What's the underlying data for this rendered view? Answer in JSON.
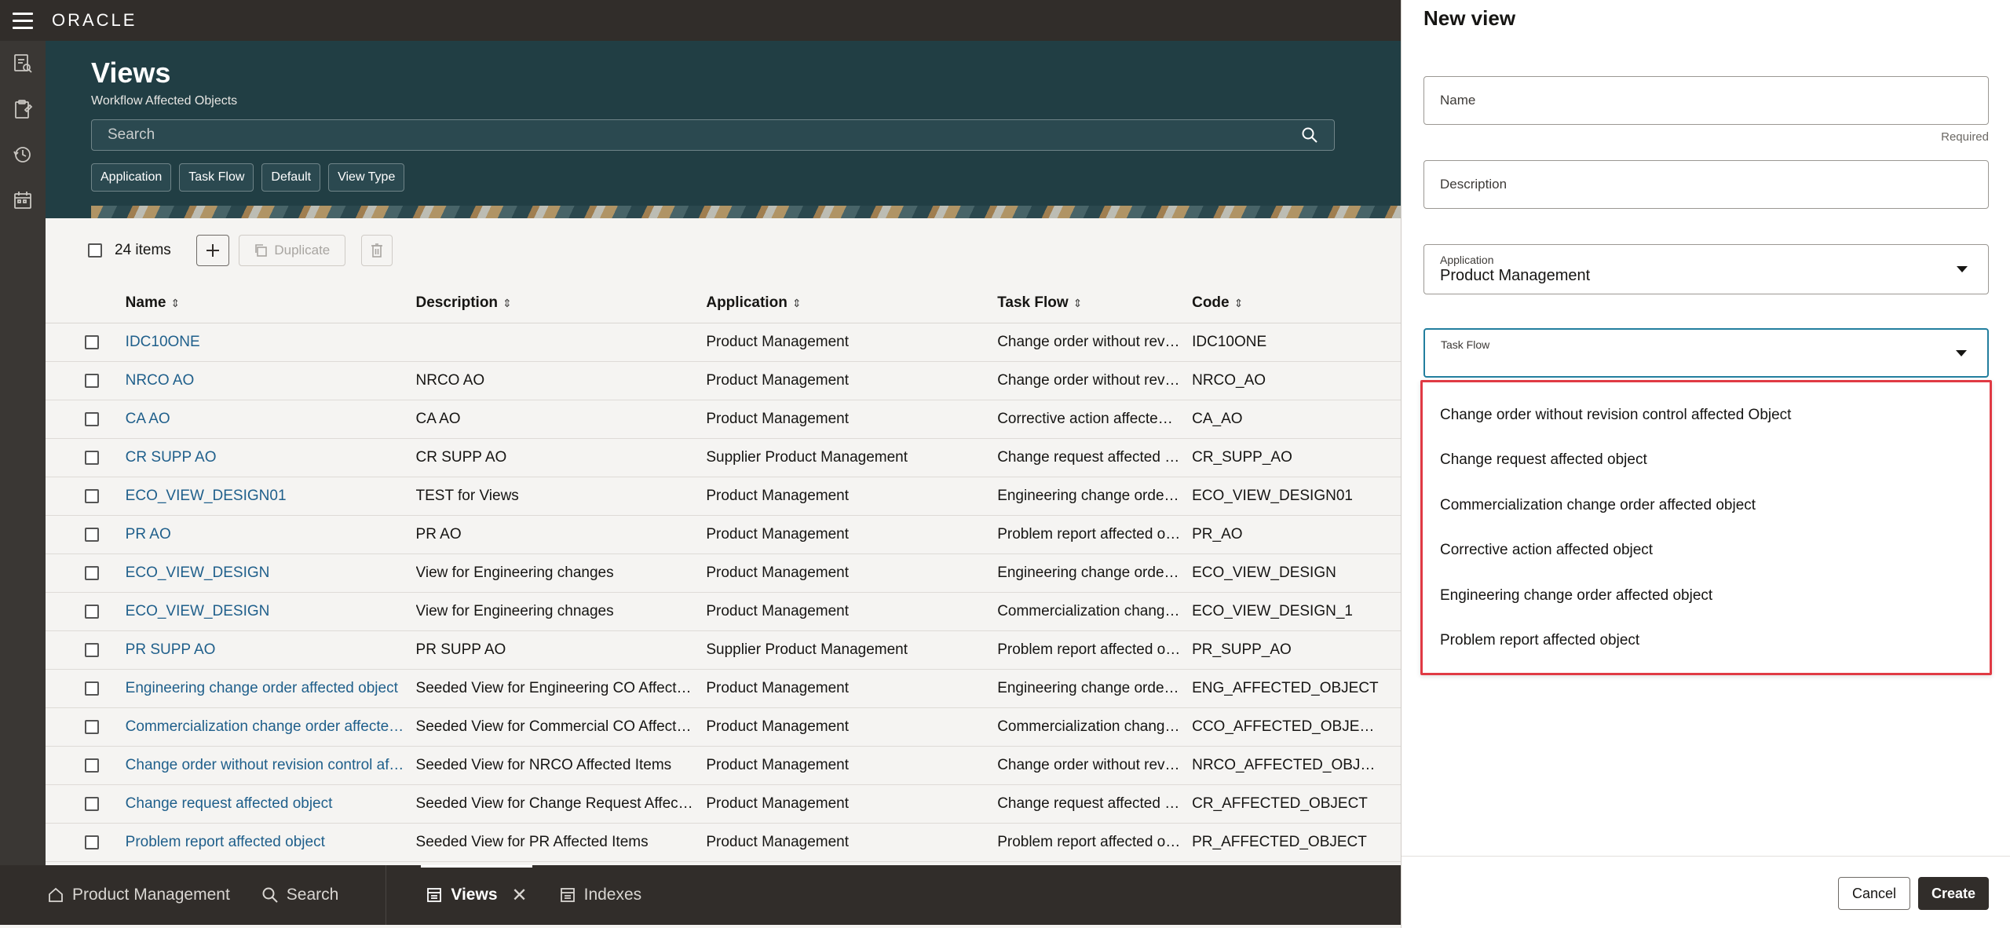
{
  "topbar": {
    "logo": "ORACLE"
  },
  "header": {
    "title": "Views",
    "subtitle": "Workflow Affected Objects",
    "search_placeholder": "Search",
    "filters": [
      "Application",
      "Task Flow",
      "Default",
      "View Type"
    ]
  },
  "toolbar": {
    "count": "24 items",
    "duplicate_label": "Duplicate"
  },
  "table": {
    "columns": [
      "Name",
      "Description",
      "Application",
      "Task Flow",
      "Code"
    ],
    "rows": [
      [
        "IDC10ONE",
        "",
        "Product Management",
        "Change order without revision control affected Object",
        "IDC10ONE"
      ],
      [
        "NRCO AO",
        "NRCO AO",
        "Product Management",
        "Change order without revision control affected Object",
        "NRCO_AO"
      ],
      [
        "CA AO",
        "CA AO",
        "Product Management",
        "Corrective action affected object",
        "CA_AO"
      ],
      [
        "CR SUPP AO",
        "CR SUPP AO",
        "Supplier Product Management",
        "Change request affected object",
        "CR_SUPP_AO"
      ],
      [
        "ECO_VIEW_DESIGN01",
        "TEST for Views",
        "Product Management",
        "Engineering change order affected object",
        "ECO_VIEW_DESIGN01"
      ],
      [
        "PR AO",
        "PR AO",
        "Product Management",
        "Problem report affected object",
        "PR_AO"
      ],
      [
        "ECO_VIEW_DESIGN",
        "View for Engineering changes",
        "Product Management",
        "Engineering change order affected object",
        "ECO_VIEW_DESIGN"
      ],
      [
        "ECO_VIEW_DESIGN",
        "View for Engineering chnages",
        "Product Management",
        "Commercialization change order affected object",
        "ECO_VIEW_DESIGN_1"
      ],
      [
        "PR SUPP AO",
        "PR SUPP AO",
        "Supplier Product Management",
        "Problem report affected object",
        "PR_SUPP_AO"
      ],
      [
        "Engineering change order affected object",
        "Seeded View for Engineering CO Affected Items",
        "Product Management",
        "Engineering change order affected object",
        "ENG_AFFECTED_OBJECT"
      ],
      [
        "Commercialization change order affected object",
        "Seeded View for Commercial CO Affected Items",
        "Product Management",
        "Commercialization change order affected object",
        "CCO_AFFECTED_OBJECT"
      ],
      [
        "Change order without revision control affected Object",
        "Seeded View for NRCO Affected Items",
        "Product Management",
        "Change order without revision control affected Object",
        "NRCO_AFFECTED_OBJECT"
      ],
      [
        "Change request affected object",
        "Seeded View for Change Request Affected Items",
        "Product Management",
        "Change request affected object",
        "CR_AFFECTED_OBJECT"
      ],
      [
        "Problem report affected object",
        "Seeded View for PR Affected Items",
        "Product Management",
        "Problem report affected object",
        "PR_AFFECTED_OBJECT"
      ]
    ]
  },
  "bottombar": {
    "items": [
      "Product Management",
      "Search",
      "Views",
      "Indexes"
    ]
  },
  "drawer": {
    "title": "New view",
    "name_label": "Name",
    "required_label": "Required",
    "description_label": "Description",
    "application_label": "Application",
    "application_value": "Product Management",
    "taskflow_label": "Task Flow",
    "taskflow_options": [
      "Change order without revision control affected Object",
      "Change request affected object",
      "Commercialization change order affected object",
      "Corrective action affected object",
      "Engineering change order affected object",
      "Problem report affected object"
    ],
    "cancel_label": "Cancel",
    "create_label": "Create"
  },
  "colors": {
    "accent_red": "#e03a44",
    "header_bg": "#213e44",
    "link": "#1f5f8b"
  }
}
